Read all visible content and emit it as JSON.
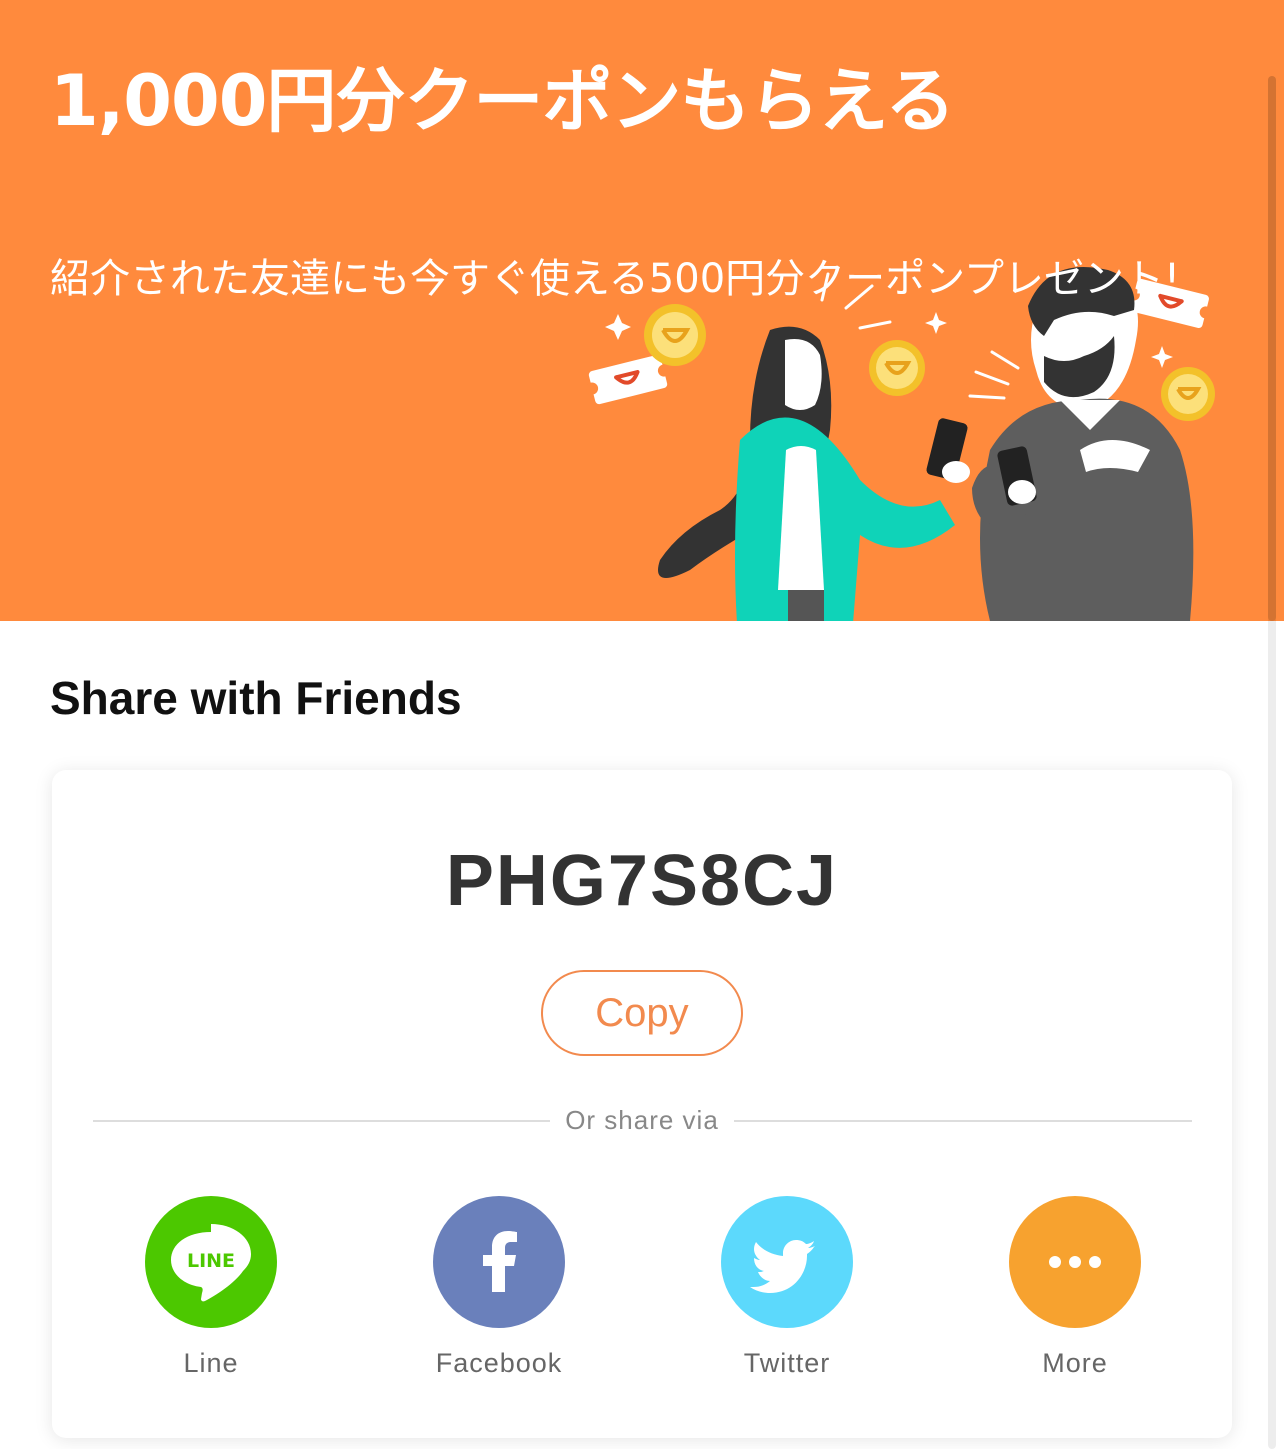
{
  "hero": {
    "title": "1,000円分クーポンもらえる",
    "subtitle": "紹介された友達にも今すぐ使える500円分クーポンプレゼント!",
    "background_color": "#FF8A3D"
  },
  "share_section": {
    "heading": "Share with Friends",
    "referral_code": "PHG7S8CJ",
    "copy_label": "Copy",
    "divider_text": "Or share via",
    "accent_color": "#F28A4E",
    "options": [
      {
        "label": "Line",
        "icon": "line-icon",
        "color": "#4CC800"
      },
      {
        "label": "Facebook",
        "icon": "facebook-icon",
        "color": "#6A80BB"
      },
      {
        "label": "Twitter",
        "icon": "twitter-icon",
        "color": "#5CD9FC"
      },
      {
        "label": "More",
        "icon": "more-icon",
        "color": "#F7A22F"
      }
    ]
  }
}
